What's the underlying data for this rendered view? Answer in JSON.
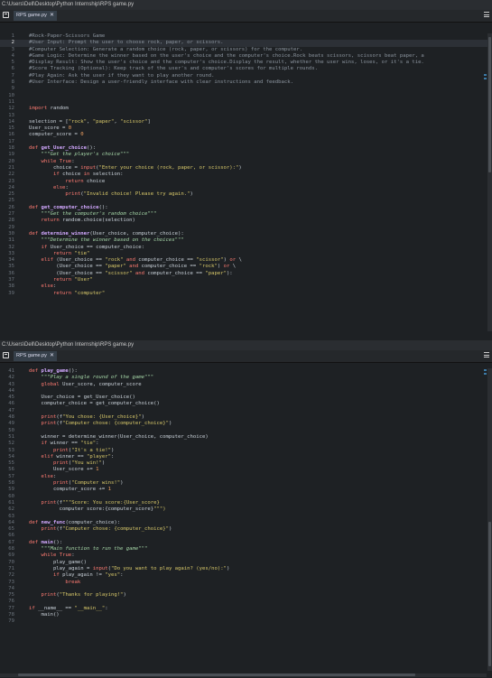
{
  "top_pane": {
    "path": "C:\\Users\\Dell\\Desktop\\Python Internship\\RPS game.py",
    "tab_label": "RPS game.py",
    "active_line": 2,
    "lines": [
      {
        "n": 1,
        "text": "#Rock-Paper-Scissors Game"
      },
      {
        "n": 2,
        "text": "#User Input: Prompt the user to choose rock, paper, or scissors."
      },
      {
        "n": 3,
        "text": "#Computer Selection: Generate a random choice (rock, paper, or scissors) for the computer."
      },
      {
        "n": 4,
        "text": "#Game Logic: Determine the winner based on the user's choice and the computer's choice.Rock beats scissors, scissors beat paper, a"
      },
      {
        "n": 5,
        "text": "#Display Result: Show the user's choice and the computer's choice.Display the result, whether the user wins, loses, or it's a tie."
      },
      {
        "n": 6,
        "text": "#Score Tracking (Optional): Keep track of the user's and computer's scores for multiple rounds."
      },
      {
        "n": 7,
        "text": "#Play Again: Ask the user if they want to play another round."
      },
      {
        "n": 8,
        "text": "#User Interface: Design a user-friendly interface with clear instructions and feedback."
      },
      {
        "n": 9,
        "text": ""
      },
      {
        "n": 10,
        "text": ""
      },
      {
        "n": 11,
        "text": ""
      },
      {
        "n": 12,
        "text": "import random"
      },
      {
        "n": 13,
        "text": ""
      },
      {
        "n": 14,
        "text": "selection = [\"rock\", \"paper\", \"scissor\"]"
      },
      {
        "n": 15,
        "text": "User_score = 0"
      },
      {
        "n": 16,
        "text": "computer_score = 0"
      },
      {
        "n": 17,
        "text": ""
      },
      {
        "n": 18,
        "text": "def get_User_choice():"
      },
      {
        "n": 19,
        "text": "    \"\"\"Get the player's choice\"\"\""
      },
      {
        "n": 20,
        "text": "    while True:"
      },
      {
        "n": 21,
        "text": "        choice = input(\"Enter your choice (rock, paper, or scissor):\")"
      },
      {
        "n": 22,
        "text": "        if choice in selection:"
      },
      {
        "n": 23,
        "text": "            return choice"
      },
      {
        "n": 24,
        "text": "        else:"
      },
      {
        "n": 25,
        "text": "            print(\"Invalid choice! Please try again.\")"
      },
      {
        "n": 25,
        "text": ""
      },
      {
        "n": 26,
        "text": "def get_computer_choice():"
      },
      {
        "n": 27,
        "text": "    \"\"\"Get the computer's random choice\"\"\""
      },
      {
        "n": 28,
        "text": "    return random.choice(selection)"
      },
      {
        "n": 29,
        "text": ""
      },
      {
        "n": 30,
        "text": "def determine_winner(User_choice, computer_choice):"
      },
      {
        "n": 31,
        "text": "    \"\"\"Determine the winner based on the choices\"\"\""
      },
      {
        "n": 32,
        "text": "    if User_choice == computer_choice:"
      },
      {
        "n": 33,
        "text": "        return \"tie\""
      },
      {
        "n": 34,
        "text": "    elif (User_choice == \"rock\" and computer_choice == \"scissor\") or \\"
      },
      {
        "n": 35,
        "text": "         (User_choice == \"paper\" and computer_choice == \"rock\") or \\"
      },
      {
        "n": 36,
        "text": "         (User_choice == \"scissor\" and computer_choice == \"paper\"):"
      },
      {
        "n": 37,
        "text": "        return \"User\""
      },
      {
        "n": 38,
        "text": "    else:"
      },
      {
        "n": 39,
        "text": "        return \"computer\""
      }
    ]
  },
  "bottom_pane": {
    "path": "C:\\Users\\Dell\\Desktop\\Python Internship\\RPS game.py",
    "tab_label": "RPS game.py",
    "lines": [
      {
        "n": 41,
        "text": "def play_game():"
      },
      {
        "n": 42,
        "text": "    \"\"\"Play a single round of the game\"\"\""
      },
      {
        "n": 43,
        "text": "    global User_score, computer_score"
      },
      {
        "n": 44,
        "text": ""
      },
      {
        "n": 45,
        "text": "    User_choice = get_User_choice()"
      },
      {
        "n": 46,
        "text": "    computer_choice = get_computer_choice()"
      },
      {
        "n": 47,
        "text": ""
      },
      {
        "n": 48,
        "text": "    print(f\"You chose: {User_choice}\")"
      },
      {
        "n": 49,
        "text": "    print(f\"Computer chose: {computer_choice}\")"
      },
      {
        "n": 50,
        "text": ""
      },
      {
        "n": 51,
        "text": "    winner = determine_winner(User_choice, computer_choice)"
      },
      {
        "n": 52,
        "text": "    if winner == \"tie\":"
      },
      {
        "n": 53,
        "text": "        print(\"It's a tie!\")"
      },
      {
        "n": 54,
        "text": "    elif winner == \"player\":"
      },
      {
        "n": 55,
        "text": "        print(\"You win!\")"
      },
      {
        "n": 56,
        "text": "        User_score += 1"
      },
      {
        "n": 57,
        "text": "    else:"
      },
      {
        "n": 58,
        "text": "        print(\"Computer wins!\")"
      },
      {
        "n": 59,
        "text": "        computer_score += 1"
      },
      {
        "n": 60,
        "text": ""
      },
      {
        "n": 61,
        "text": "    print(f\"\"\"Score: You score:{User_score}"
      },
      {
        "n": 62,
        "text": "          computer score:{computer_score}\"\"\")"
      },
      {
        "n": 63,
        "text": ""
      },
      {
        "n": 64,
        "text": "def new_func(computer_choice):"
      },
      {
        "n": 65,
        "text": "    print(f\"Computer chose: {computer_choice}\")"
      },
      {
        "n": 66,
        "text": ""
      },
      {
        "n": 67,
        "text": "def main():"
      },
      {
        "n": 68,
        "text": "    \"\"\"Main function to run the game\"\"\""
      },
      {
        "n": 69,
        "text": "    while True:"
      },
      {
        "n": 70,
        "text": "        play_game()"
      },
      {
        "n": 71,
        "text": "        play_again = input(\"Do you want to play again? (yes/no):\")"
      },
      {
        "n": 72,
        "text": "        if play_again != \"yes\":"
      },
      {
        "n": 73,
        "text": "            break"
      },
      {
        "n": 74,
        "text": ""
      },
      {
        "n": 75,
        "text": "    print(\"Thanks for playing!\")"
      },
      {
        "n": 76,
        "text": ""
      },
      {
        "n": 77,
        "text": "if __name__ == \"__main__\":"
      },
      {
        "n": 78,
        "text": "    main()"
      },
      {
        "n": 79,
        "text": ""
      }
    ]
  },
  "colors": {
    "background": "#1e2124",
    "comment": "#8b949e",
    "keyword": "#ff7b72",
    "function": "#d2a8ff",
    "string": "#d9c96a",
    "docstring": "#a5d6a7",
    "number": "#f0a060",
    "identifier": "#c9d1d9"
  }
}
